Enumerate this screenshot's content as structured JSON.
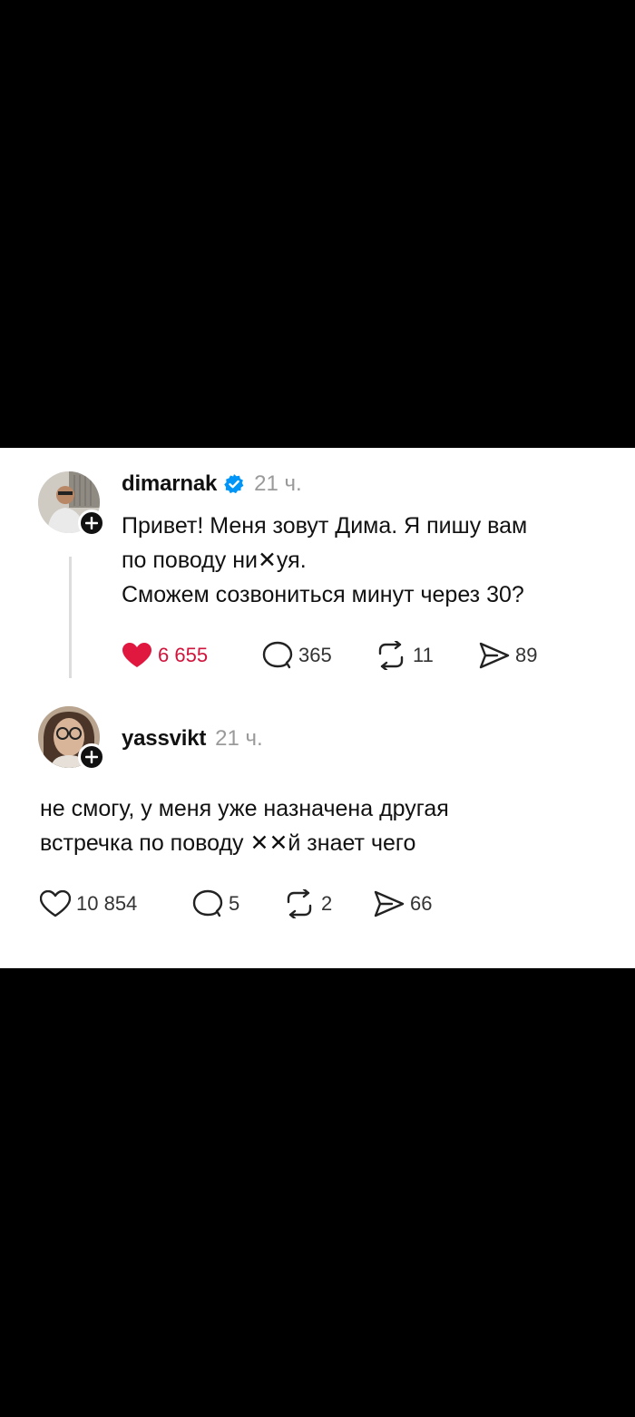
{
  "posts": [
    {
      "username": "dimarnak",
      "verified": true,
      "time": "21 ч.",
      "text_lines": [
        "Привет! Меня зовут Дима. Я пишу вам",
        "по поводу ни✕уя.",
        "Сможем созвониться минут через 30?"
      ],
      "liked": true,
      "likes": "6 655",
      "replies": "365",
      "reposts": "11",
      "shares": "89"
    },
    {
      "username": "yassvikt",
      "verified": false,
      "time": "21 ч.",
      "text_lines": [
        "не смогу, у меня уже назначена другая",
        "встречка по поводу ✕✕й знает чего"
      ],
      "liked": false,
      "likes": "10 854",
      "replies": "5",
      "reposts": "2",
      "shares": "66"
    }
  ],
  "colors": {
    "like_active": "#e0183f",
    "verified": "#0095f6",
    "muted": "#9a9a9a"
  },
  "icons": [
    "heart-icon",
    "reply-icon",
    "repost-icon",
    "share-icon",
    "plus-icon",
    "verified-badge-icon"
  ]
}
